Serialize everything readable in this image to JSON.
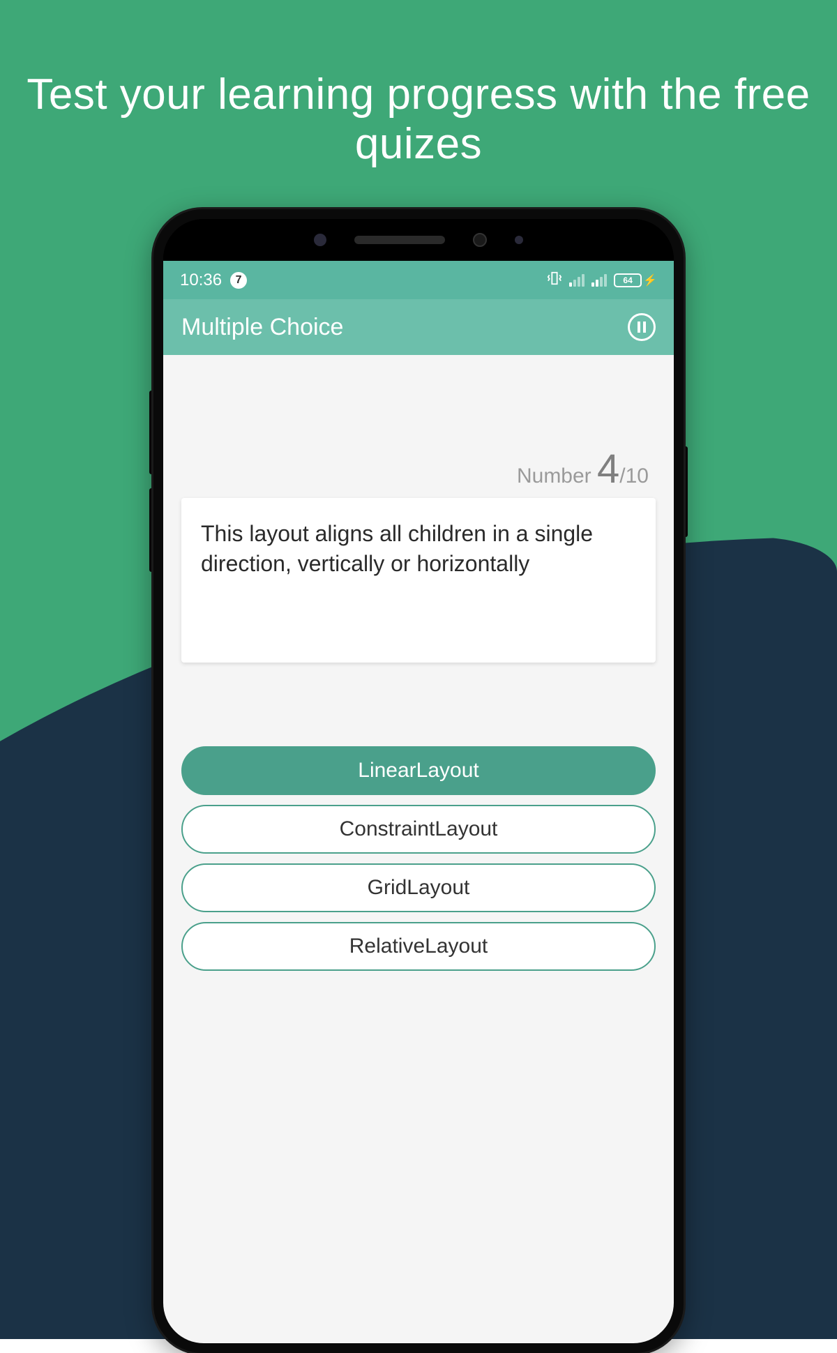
{
  "headline": "Test your learning progress with the free quizes",
  "status": {
    "time": "10:36",
    "notification_count": "7",
    "battery": "64"
  },
  "appbar": {
    "title": "Multiple Choice"
  },
  "progress": {
    "label": "Number",
    "current": "4",
    "total": "10"
  },
  "question": "This layout aligns all children in a single direction, vertically or horizontally",
  "options": {
    "0": "LinearLayout",
    "1": "ConstraintLayout",
    "2": "GridLayout",
    "3": "RelativeLayout"
  }
}
